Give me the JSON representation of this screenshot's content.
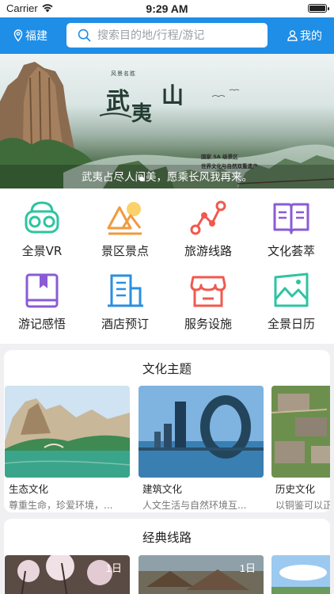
{
  "status_bar": {
    "carrier": "Carrier",
    "time": "9:29 AM"
  },
  "header": {
    "location": "福建",
    "search_placeholder": "搜索目的地/行程/游记",
    "mine": "我的",
    "bg_color": "#1f8ee6"
  },
  "banner": {
    "caption": "武夷占尽人间美，愿乘长风我再来。",
    "seal_text": "风景名胜",
    "calligraphy": "武夷山",
    "side_text_1": "国家 5A 级景区",
    "side_text_2": "世界文化与自然双重遗产"
  },
  "menu": [
    {
      "label": "全景VR",
      "icon": "vr-headset-icon"
    },
    {
      "label": "景区景点",
      "icon": "mountain-sun-icon"
    },
    {
      "label": "旅游线路",
      "icon": "route-icon"
    },
    {
      "label": "文化荟萃",
      "icon": "open-book-icon"
    },
    {
      "label": "游记感悟",
      "icon": "bookmark-book-icon"
    },
    {
      "label": "酒店预订",
      "icon": "building-icon"
    },
    {
      "label": "服务设施",
      "icon": "storefront-icon"
    },
    {
      "label": "全景日历",
      "icon": "landscape-calendar-icon"
    }
  ],
  "culture": {
    "title": "文化主题",
    "cards": [
      {
        "name": "生态文化",
        "desc": "尊重生命，珍爱环境，..."
      },
      {
        "name": "建筑文化",
        "desc": "人文生活与自然环境互..."
      },
      {
        "name": "历史文化",
        "desc": "以铜鉴可以正衣冠"
      }
    ]
  },
  "routes": {
    "title": "经典线路",
    "cards": [
      {
        "days": "1日"
      },
      {
        "days": "1日"
      },
      {
        "days": ""
      }
    ]
  }
}
